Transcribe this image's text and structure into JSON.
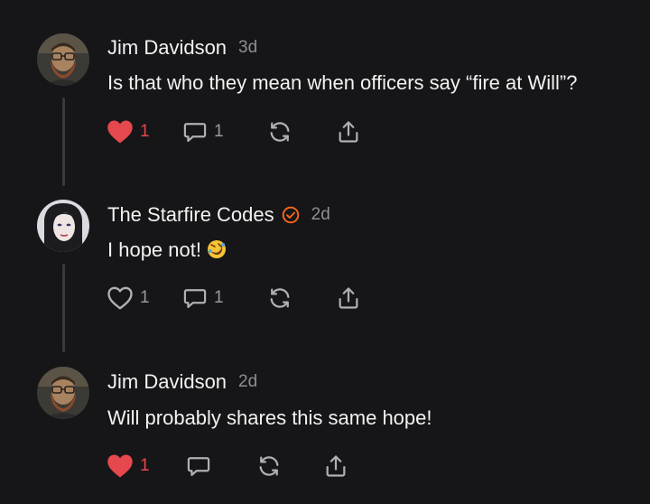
{
  "colors": {
    "background": "#161618",
    "text_primary": "#f2f2f2",
    "text_secondary": "#8e8e93",
    "like_active": "#e5484d",
    "verified_badge": "#ff6719",
    "thread_line": "#3a3a3c"
  },
  "comments": [
    {
      "author": "Jim Davidson",
      "time": "3d",
      "verified": false,
      "text": "Is that who they mean when officers say “fire at Will”?",
      "emoji": "",
      "liked": true,
      "like_count": "1",
      "reply_count": "1",
      "icons": [
        "heart-icon",
        "comment-icon",
        "restack-icon",
        "share-icon"
      ]
    },
    {
      "author": "The Starfire Codes",
      "time": "2d",
      "verified": true,
      "text": "I hope not!",
      "emoji": "rolling-on-floor-laughing-emoji",
      "liked": false,
      "like_count": "1",
      "reply_count": "1",
      "icons": [
        "heart-icon",
        "comment-icon",
        "restack-icon",
        "share-icon"
      ]
    },
    {
      "author": "Jim Davidson",
      "time": "2d",
      "verified": false,
      "text": "Will probably shares this same hope!",
      "emoji": "",
      "liked": true,
      "like_count": "1",
      "reply_count": "",
      "icons": [
        "heart-icon",
        "comment-icon",
        "restack-icon",
        "share-icon"
      ]
    }
  ]
}
